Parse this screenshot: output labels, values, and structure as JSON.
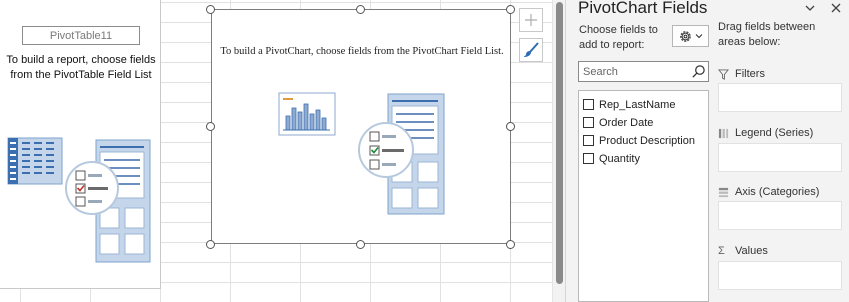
{
  "pivot_table": {
    "name": "PivotTable11",
    "message": "To build a report, choose fields from the PivotTable Field List"
  },
  "pivot_chart": {
    "message": "To build a PivotChart, choose fields from the PivotChart Field List."
  },
  "side_buttons": [
    {
      "icon": "plus-icon"
    },
    {
      "icon": "paintbrush-icon"
    }
  ],
  "field_pane": {
    "title": "PivotChart Fields",
    "choose_label": "Choose fields to add to report:",
    "settings_icon": "gear-icon",
    "search": {
      "placeholder": "Search",
      "value": ""
    },
    "fields": [
      {
        "label": "Rep_LastName",
        "checked": false
      },
      {
        "label": "Order Date",
        "checked": false
      },
      {
        "label": "Product Description",
        "checked": false
      },
      {
        "label": "Quantity",
        "checked": false
      }
    ],
    "drag_label": "Drag fields between areas below:",
    "areas": [
      {
        "label": "Filters",
        "icon": "filter-icon"
      },
      {
        "label": "Legend (Series)",
        "icon": "columns-icon"
      },
      {
        "label": "Axis (Categories)",
        "icon": "rows-icon"
      },
      {
        "label": "Values",
        "icon": "sigma-icon"
      }
    ]
  },
  "colors": {
    "accent": "#2e6db4",
    "illustration_blue": "#c5d6ea",
    "check_green": "#1e8c3a",
    "check_red": "#c0392b"
  }
}
